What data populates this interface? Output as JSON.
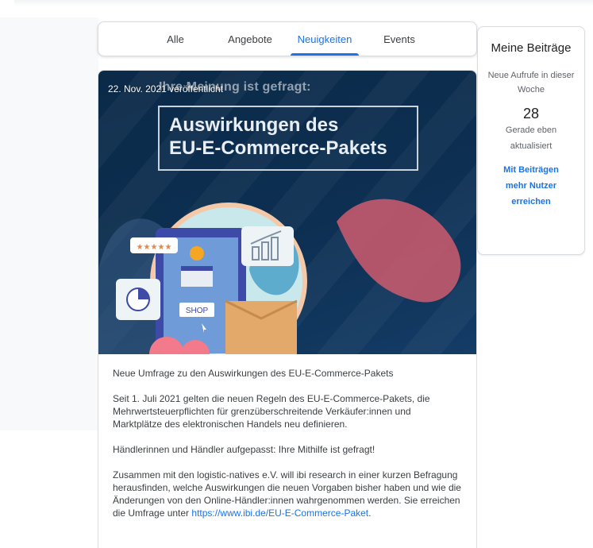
{
  "tabs": [
    {
      "label": "Alle",
      "active": false
    },
    {
      "label": "Angebote",
      "active": false
    },
    {
      "label": "Neuigkeiten",
      "active": true
    },
    {
      "label": "Events",
      "active": false
    }
  ],
  "side": {
    "title": "Meine Beiträge",
    "sub": "Neue Aufrufe in dieser Woche",
    "count": "28",
    "updated": "Gerade eben aktualisiert",
    "link": "Mit Beiträgen mehr Nutzer erreichen"
  },
  "post": {
    "date": "22. Nov. 2021 veröffentlicht",
    "kicker": "Ihre Meinung ist gefragt:",
    "headline_line1": "Auswirkungen des",
    "headline_line2": "EU-E-Commerce-Pakets",
    "shop_label": "SHOP",
    "stars": "★★★★★",
    "p1": "Neue Umfrage zu den Auswirkungen des EU-E-Commerce-Pakets",
    "p2": "Seit 1. Juli 2021 gelten die neuen Regeln des EU-E-Commerce-Pakets, die Mehrwertsteuerpflichten für grenzüberschreitende Verkäufer:innen und Marktplätze des elektronischen Handels neu definieren.",
    "p3": "Händlerinnen und Händler aufgepasst: Ihre Mithilfe ist gefragt!",
    "p4_text": "Zusammen mit den logistic-natives e.V. will ibi research in einer kurzen Befragung herausfinden, welche Auswirkungen die neuen Vorgaben bisher haben und wie die Änderungen von den Online-Händler:innen wahrgenommen werden. Sie erreichen die Umfrage unter ",
    "p4_link": "https://www.ibi.de/EU-E-Commerce-Paket",
    "p4_end": "."
  },
  "colors": {
    "accent": "#1a73e8",
    "hero_bg": "#0d2f52",
    "illustration_circle": "#c8e8ec",
    "pink": "#f27a8a",
    "tablet": "#3d4aa8",
    "box": "#e2a96a"
  }
}
